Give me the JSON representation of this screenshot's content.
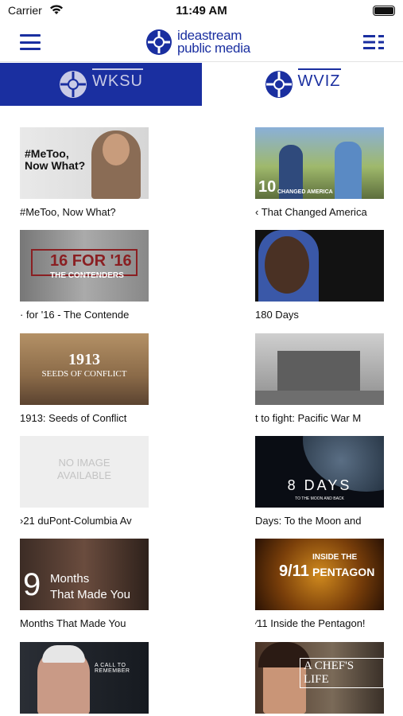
{
  "status_bar": {
    "carrier": "Carrier",
    "time": "11:49 AM"
  },
  "header": {
    "logo_line1": "ideastream",
    "logo_line2": "public media"
  },
  "tabs": [
    {
      "label": "WKSU",
      "selected": true
    },
    {
      "label": "WVIZ",
      "selected": false
    }
  ],
  "colors": {
    "brand_blue": "#1a2fa0"
  },
  "shows": [
    {
      "caption": "#MeToo, Now What?",
      "thumb_text": "#MeToo,\nNow What?"
    },
    {
      "caption": "‹ That Changed America",
      "thumb_text": "10 CHANGED AMERICA"
    },
    {
      "caption": "· for '16 - The Contende",
      "thumb_text": "16 FOR '16"
    },
    {
      "caption": "180 Days",
      "thumb_text": ""
    },
    {
      "caption": "1913: Seeds of Conflict",
      "thumb_text": "1913"
    },
    {
      "caption": "t to fight: Pacific War M",
      "thumb_text": ""
    },
    {
      "caption": "›21 duPont-Columbia Av",
      "thumb_text": "NO IMAGE AVAILABLE"
    },
    {
      "caption": "Days: To the Moon and",
      "thumb_text": "8 DAYS"
    },
    {
      "caption": "Months That Made You",
      "thumb_text": "9 Months That Made You"
    },
    {
      "caption": "⁄11 Inside the Pentagon!",
      "thumb_text": "9/11 INSIDE THE PENTAGON"
    },
    {
      "caption": "",
      "thumb_text": "A CALL TO REMEMBER"
    },
    {
      "caption": "",
      "thumb_text": "A CHEF'S LIFE"
    }
  ],
  "thumb_labels": {
    "metoo": "#MeToo,",
    "metoo2": "Now What?",
    "ten_num": "10",
    "ten_sub": "CHANGED AMERICA",
    "sixteen": "16 FOR '16",
    "sixteen_sub": "THE CONTENDERS",
    "y1913": "1913",
    "seeds": "SEEDS OF CONFLICT",
    "noimage1": "NO IMAGE",
    "noimage2": "AVAILABLE",
    "eightdays": "8 DAYS",
    "eightsub": "TO THE MOON AND BACK",
    "nine_num": "9",
    "nine_l1": "Months",
    "nine_l2": "That Made You",
    "pent_top": "INSIDE THE",
    "pent_num": "9/11",
    "pent_bottom": "PENTAGON",
    "call": "A CALL TO REMEMBER",
    "chef": "A CHEF'S LIFE"
  }
}
